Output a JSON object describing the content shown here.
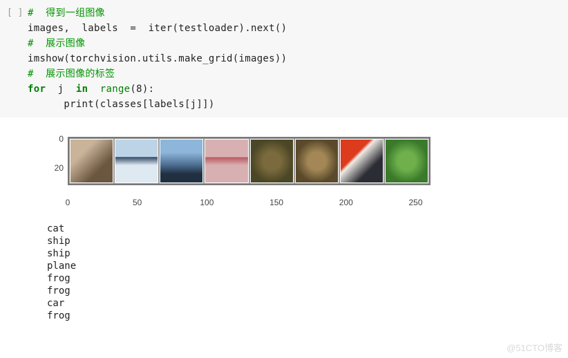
{
  "code": {
    "gutter": "[ ]",
    "lines": [
      {
        "kind": "comment",
        "text": "#  得到一组图像"
      },
      {
        "kind": "code",
        "text": "images,  labels  =  iter(testloader).next()"
      },
      {
        "kind": "comment",
        "text": "#  展示图像"
      },
      {
        "kind": "code",
        "text": "imshow(torchvision.utils.make_grid(images))"
      },
      {
        "kind": "comment",
        "text": "#  展示图像的标签"
      },
      {
        "kind": "for",
        "text_prefix": "for",
        "mid": "  j  ",
        "in": "in",
        "post": "  range",
        "arg": "(8):"
      },
      {
        "kind": "code",
        "text": "      print(classes[labels[j]])"
      }
    ]
  },
  "chart_data": {
    "type": "image-grid",
    "y_ticks": [
      0,
      20
    ],
    "x_ticks": [
      0,
      50,
      100,
      150,
      200,
      250
    ],
    "x_range": [
      0,
      260
    ],
    "thumb_count": 8
  },
  "output_lines": [
    "cat",
    "ship",
    "ship",
    "plane",
    "frog",
    "frog",
    "car",
    "frog"
  ],
  "watermark": "@51CTO博客"
}
